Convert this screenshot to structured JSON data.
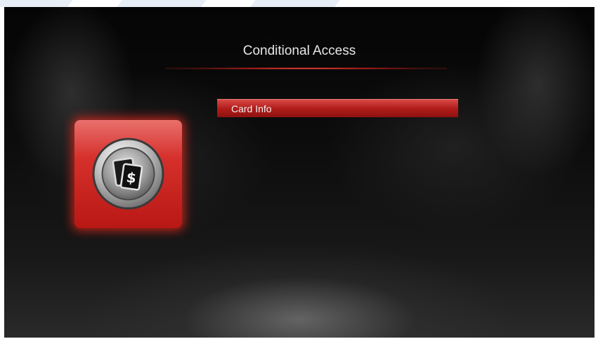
{
  "header": {
    "title": "Conditional Access"
  },
  "menu": {
    "items": [
      {
        "label": "Card Info",
        "selected": true
      }
    ]
  },
  "tile": {
    "icon": "card-dollar-icon"
  },
  "colors": {
    "accent": "#c0201c",
    "title_text": "#e6e6e6",
    "background": "#0a0a0a"
  }
}
